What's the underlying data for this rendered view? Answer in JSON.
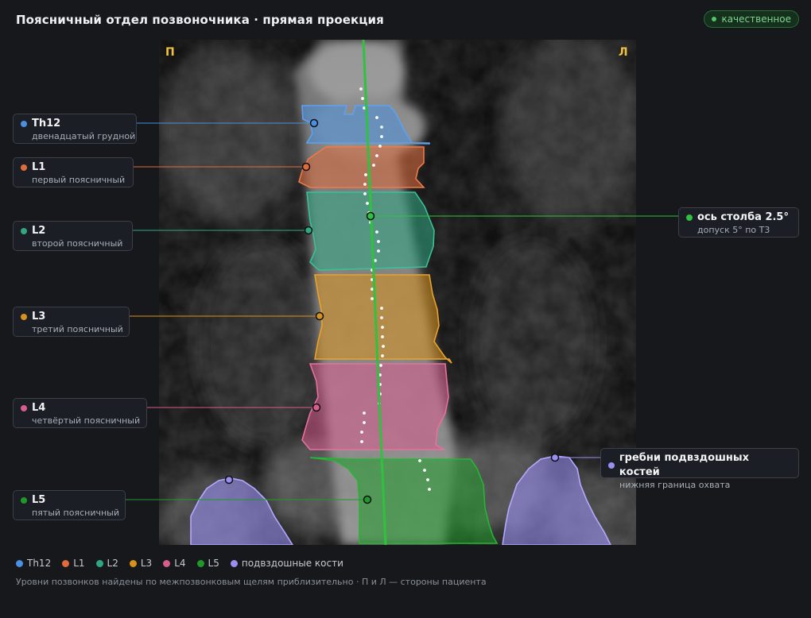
{
  "header": {
    "title": "Поясничный отдел позвоночника · прямая проекция",
    "badge": "качественное"
  },
  "image": {
    "left_mark": "П",
    "right_mark": "Л"
  },
  "colors": {
    "Th12": "#4a8fe0",
    "L1": "#e06c3c",
    "L2": "#2fa882",
    "L3": "#d8921c",
    "L4": "#d85c8c",
    "L5": "#1f9a2a",
    "iliac": "#9a8ff0",
    "axis": "#2ec23e"
  },
  "callouts": {
    "th12": {
      "name": "Th12",
      "desc": "двенадцатый грудной"
    },
    "l1": {
      "name": "L1",
      "desc": "первый поясничный"
    },
    "l2": {
      "name": "L2",
      "desc": "второй поясничный"
    },
    "l3": {
      "name": "L3",
      "desc": "третий поясничный"
    },
    "l4": {
      "name": "L4",
      "desc": "четвёртый поясничный"
    },
    "l5": {
      "name": "L5",
      "desc": "пятый поясничный"
    },
    "axis": {
      "name": "ось столба 2.5°",
      "desc": "допуск 5° по Т3"
    },
    "iliac": {
      "name": "гребни подвздошных костей",
      "desc": "нижняя граница охвата"
    }
  },
  "legend": [
    {
      "label": "Th12",
      "color": "#4a8fe0"
    },
    {
      "label": "L1",
      "color": "#e06c3c"
    },
    {
      "label": "L2",
      "color": "#2fa882"
    },
    {
      "label": "L3",
      "color": "#d8921c"
    },
    {
      "label": "L4",
      "color": "#d85c8c"
    },
    {
      "label": "L5",
      "color": "#1f9a2a"
    },
    {
      "label": "подвздошные кости",
      "color": "#9a8ff0"
    }
  ],
  "footnote": "Уровни позвонков найдены по межпозвонковым щелям приблизительно · П и Л — стороны пациента"
}
